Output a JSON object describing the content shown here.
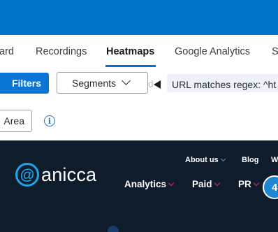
{
  "tabs": [
    {
      "label": "ard",
      "active": false
    },
    {
      "label": "Recordings",
      "active": false
    },
    {
      "label": "Heatmaps",
      "active": true
    },
    {
      "label": "Google Analytics",
      "active": false
    },
    {
      "label": "S",
      "active": false
    }
  ],
  "toolbar": {
    "filters_label": "Filters",
    "segments_label": "Segments",
    "faded_text": "d",
    "url_filter_text": "URL matches regex: ^ht"
  },
  "row3": {
    "area_label": "Area",
    "info_glyph": "i"
  },
  "site": {
    "logo_mark": "@",
    "logo_text": "anicca",
    "top_nav": [
      "About us",
      "Blog",
      "W"
    ],
    "main_nav": [
      "Analytics",
      "Paid",
      "PR"
    ],
    "circle_label": "4"
  },
  "colors": {
    "topbar": "#0073c6",
    "primary_button": "#0a75d4",
    "site_bg": "#0e1c2b",
    "accent_pink": "#e0306a",
    "accent_blue": "#1fa6ea"
  }
}
